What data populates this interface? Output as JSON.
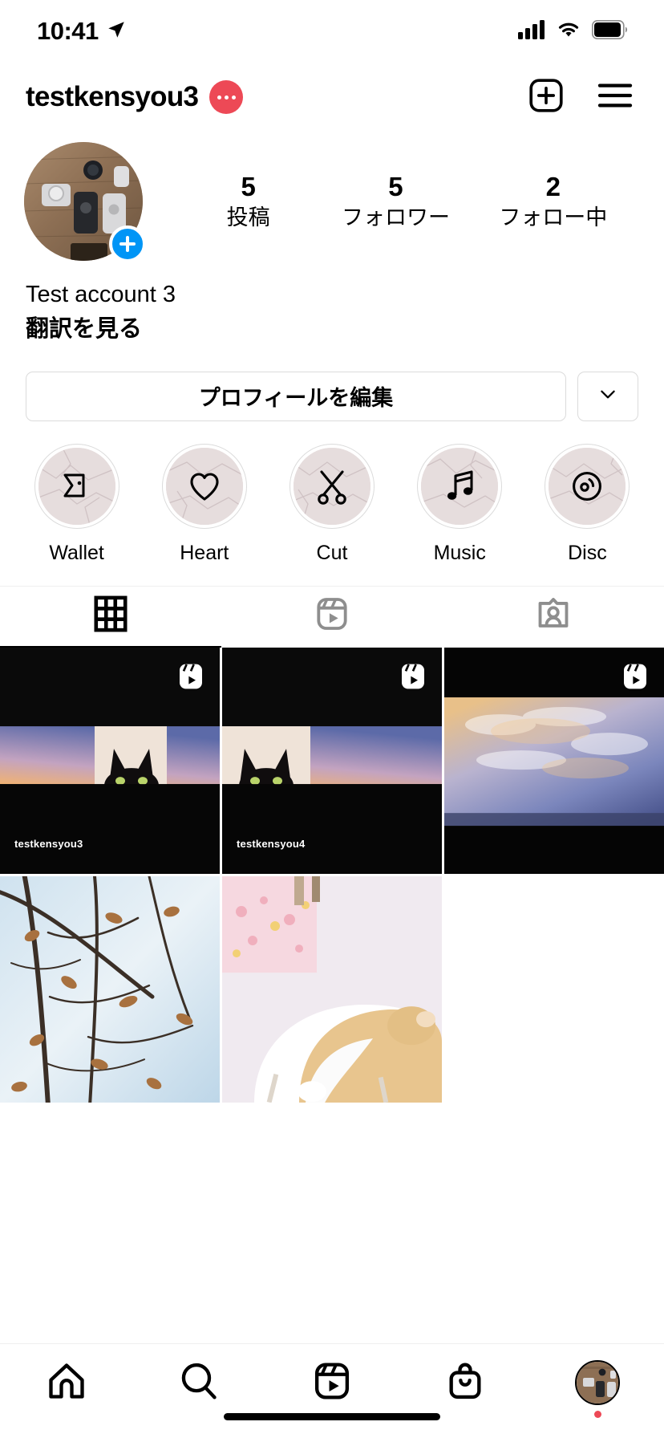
{
  "status_bar": {
    "time": "10:41",
    "location_icon": "location-arrow-icon",
    "signal_icon": "cellular-signal-icon",
    "wifi_icon": "wifi-icon",
    "battery_icon": "battery-icon"
  },
  "header": {
    "username": "testkensyou3",
    "threads_badge_icon": "threads-dot-badge-icon",
    "new_post_icon": "new-post-plus-icon",
    "menu_icon": "hamburger-menu-icon"
  },
  "profile": {
    "avatar_icon": "profile-avatar",
    "add_story_icon": "add-story-plus-icon",
    "stats": [
      {
        "value": "5",
        "label": "投稿"
      },
      {
        "value": "5",
        "label": "フォロワー"
      },
      {
        "value": "2",
        "label": "フォロー中"
      }
    ],
    "display_name": "Test account 3",
    "translate_link": "翻訳を見る"
  },
  "actions": {
    "edit_profile_label": "プロフィールを編集",
    "dropdown_icon": "chevron-down-icon"
  },
  "highlights": [
    {
      "label": "Wallet",
      "icon": "wallet-icon"
    },
    {
      "label": "Heart",
      "icon": "heart-icon"
    },
    {
      "label": "Cut",
      "icon": "scissors-icon"
    },
    {
      "label": "Music",
      "icon": "music-note-icon"
    },
    {
      "label": "Disc",
      "icon": "disc-icon"
    }
  ],
  "tabs": [
    {
      "name": "grid",
      "icon": "grid-icon",
      "active": true
    },
    {
      "name": "reels",
      "icon": "reels-icon",
      "active": false
    },
    {
      "name": "tagged",
      "icon": "tagged-person-icon",
      "active": false
    }
  ],
  "posts": [
    {
      "type": "reel",
      "badge_icon": "reel-play-icon",
      "overlay_username": "testkensyou3",
      "scene": "sunset-sky-with-black-cat"
    },
    {
      "type": "reel",
      "badge_icon": "reel-play-icon",
      "overlay_username": "testkensyou4",
      "scene": "black-cat-with-sunset-sky"
    },
    {
      "type": "reel",
      "badge_icon": "reel-play-icon",
      "overlay_username": "",
      "scene": "sunset-clouds-over-sea"
    },
    {
      "type": "photo",
      "badge_icon": "",
      "overlay_username": "",
      "scene": "winter-branches-with-leaves"
    },
    {
      "type": "photo",
      "badge_icon": "",
      "overlay_username": "",
      "scene": "sleeping-ginger-cat"
    },
    {
      "type": "empty",
      "badge_icon": "",
      "overlay_username": "",
      "scene": ""
    }
  ],
  "bottom_nav": [
    {
      "name": "home",
      "icon": "home-icon"
    },
    {
      "name": "search",
      "icon": "search-icon"
    },
    {
      "name": "reels",
      "icon": "reels-icon"
    },
    {
      "name": "shop",
      "icon": "shop-bag-icon"
    },
    {
      "name": "profile",
      "icon": "profile-avatar-icon"
    }
  ],
  "colors": {
    "accent_blue": "#0095F6",
    "badge_red": "#ED4956",
    "border": "#DBDBDB",
    "inactive_gray": "#8E8E8E"
  }
}
